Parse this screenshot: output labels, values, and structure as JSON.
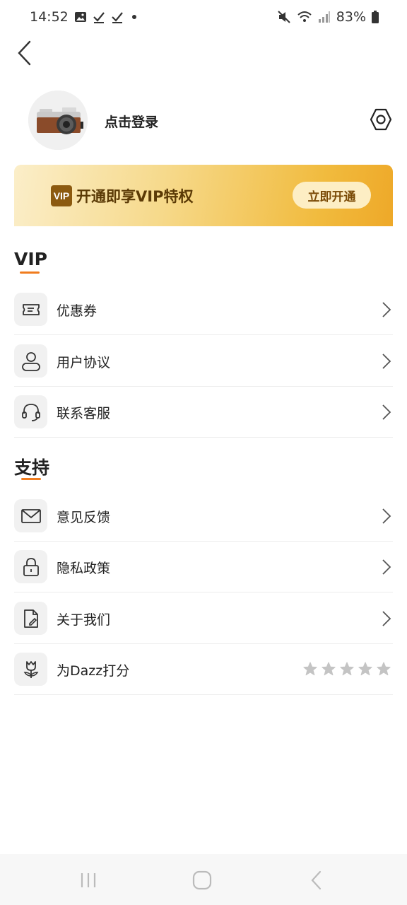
{
  "status_bar": {
    "time": "14:52",
    "battery": "83%"
  },
  "profile": {
    "login_label": "点击登录"
  },
  "vip_banner": {
    "badge": "VIP",
    "title": "开通即享VIP特权",
    "button": "立即开通"
  },
  "sections": {
    "vip": {
      "title": "VIP",
      "items": [
        {
          "label": "优惠券",
          "icon": "coupon-icon"
        },
        {
          "label": "用户协议",
          "icon": "user-icon"
        },
        {
          "label": "联系客服",
          "icon": "headset-icon"
        }
      ]
    },
    "support": {
      "title": "支持",
      "items": [
        {
          "label": "意见反馈",
          "icon": "mail-icon"
        },
        {
          "label": "隐私政策",
          "icon": "lock-icon"
        },
        {
          "label": "关于我们",
          "icon": "document-edit-icon"
        },
        {
          "label": "为Dazz打分",
          "icon": "tulip-icon",
          "rating_max": 5,
          "rating_value": 0
        }
      ]
    }
  },
  "colors": {
    "accent": "#f07c1e",
    "banner_gold": "#f1bb3e"
  }
}
